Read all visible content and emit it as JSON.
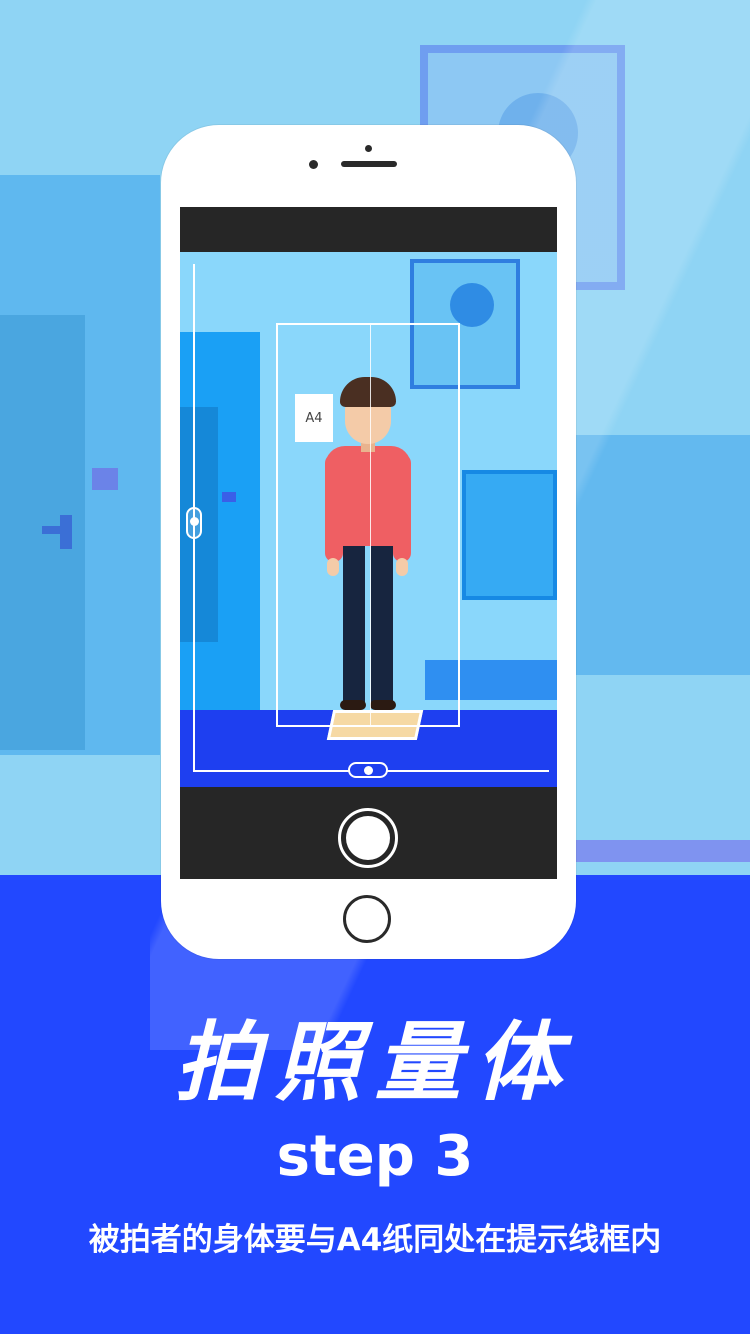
{
  "hero": {
    "title": "拍照量体",
    "step": "step 3",
    "subtitle": "被拍者的身体要与A4纸同处在提示线框内"
  },
  "viewfinder": {
    "a4_label": "A4"
  },
  "colors": {
    "sky": "#8fd4f4",
    "accent_blue": "#2248ff",
    "shirt": "#ef5f63",
    "phone_body": "#ffffff",
    "screen_bar": "#262626"
  },
  "icons": [
    "shutter-button-icon",
    "home-button-icon",
    "front-camera-icon",
    "speaker-icon",
    "vertical-slider-icon",
    "horizontal-slider-icon"
  ]
}
